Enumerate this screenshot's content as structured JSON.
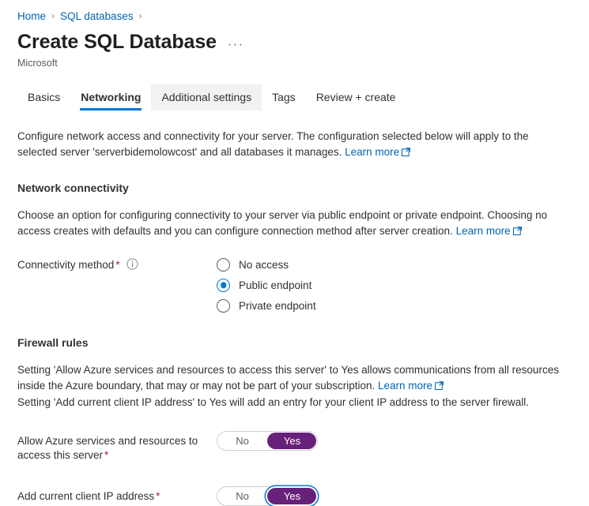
{
  "breadcrumb": {
    "items": [
      {
        "label": "Home"
      },
      {
        "label": "SQL databases"
      }
    ],
    "separator": "›"
  },
  "header": {
    "title": "Create SQL Database",
    "publisher": "Microsoft",
    "more_commands": "···",
    "more_commands_name": "ellipsis-icon"
  },
  "tabs": [
    {
      "label": "Basics",
      "selected": false,
      "hovered": false
    },
    {
      "label": "Networking",
      "selected": true,
      "hovered": false
    },
    {
      "label": "Additional settings",
      "selected": false,
      "hovered": true
    },
    {
      "label": "Tags",
      "selected": false,
      "hovered": false
    },
    {
      "label": "Review + create",
      "selected": false,
      "hovered": false
    }
  ],
  "intro": {
    "text": "Configure network access and connectivity for your server. The configuration selected below will apply to the selected server 'serverbidemolowcost' and all databases it manages.",
    "learn_more": "Learn more"
  },
  "network_connectivity": {
    "heading": "Network connectivity",
    "description": "Choose an option for configuring connectivity to your server via public endpoint or private endpoint. Choosing no access creates with defaults and you can configure connection method after server creation.",
    "learn_more": "Learn more",
    "connectivity_method": {
      "label": "Connectivity method",
      "required_marker": "*",
      "info_glyph": "i",
      "options": [
        {
          "label": "No access",
          "checked": false
        },
        {
          "label": "Public endpoint",
          "checked": true
        },
        {
          "label": "Private endpoint",
          "checked": false
        }
      ]
    }
  },
  "firewall_rules": {
    "heading": "Firewall rules",
    "description_line1": "Setting 'Allow Azure services and resources to access this server' to Yes allows communications from all resources inside the Azure boundary, that may or may not be part of your subscription.",
    "learn_more": "Learn more",
    "description_line2": "Setting 'Add current client IP address' to Yes will add an entry for your client IP address to the server firewall.",
    "toggles": [
      {
        "label": "Allow Azure services and resources to access this server",
        "required_marker": "*",
        "off_label": "No",
        "on_label": "Yes",
        "value": "Yes",
        "focused": false
      },
      {
        "label": "Add current client IP address",
        "required_marker": "*",
        "off_label": "No",
        "on_label": "Yes",
        "value": "Yes",
        "focused": true
      }
    ]
  },
  "colors": {
    "accent_blue": "#0078d4",
    "link_blue": "#0063b1",
    "toggle_purple": "#68217a",
    "required_red": "#a4262c",
    "tab_hover_gray": "#f3f2f1"
  }
}
